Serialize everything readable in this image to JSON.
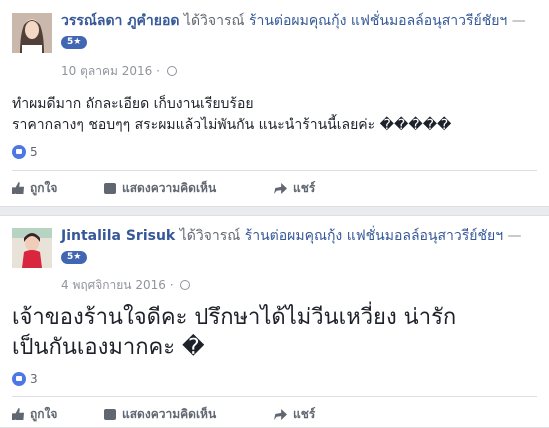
{
  "posts": [
    {
      "author": "วรรณ์ลดา ภูคำยอด",
      "verb": "ได้วิจารณ์",
      "page": "ร้านต่อผมคุณกุ้ง แฟชั่นมอลล์อนุสาวรีย์ชัยฯ",
      "dash": "—",
      "rating": "5★",
      "date": "10 ตุลาคม 2016",
      "dot": "·",
      "lines": [
        "ทำผมดีมาก ถักละเอียด เก็บงานเรียบร้อย",
        "ราคากลางๆ ชอบๆๆ สระผมแล้วไม่พันกัน แนะนำร้านนี้เลยค่ะ �����"
      ],
      "likes": "5"
    },
    {
      "author": "Jintalila Srisuk",
      "verb": "ได้วิจารณ์",
      "page": "ร้านต่อผมคุณกุ้ง แฟชั่นมอลล์อนุสาวรีย์ชัยฯ",
      "dash": "—",
      "rating": "5★",
      "date": "4 พฤศจิกายน 2016",
      "dot": "·",
      "lines": [
        "เจ้าของร้านใจดีคะ ปรึกษาได้ไม่วีนเหวี่ยง น่ารัก",
        "เป็นกันเองมากคะ �"
      ],
      "likes": "3"
    }
  ],
  "actions": {
    "like": "ถูกใจ",
    "comment": "แสดงความคิดเห็น",
    "share": "แชร์"
  },
  "icons": {
    "like": "thumbs-up-icon",
    "comment": "comment-icon",
    "share": "share-arrow-icon",
    "privacy": "globe-icon"
  },
  "colors": {
    "link": "#365899",
    "badge": "#4267b2",
    "like": "#4d77e4"
  }
}
